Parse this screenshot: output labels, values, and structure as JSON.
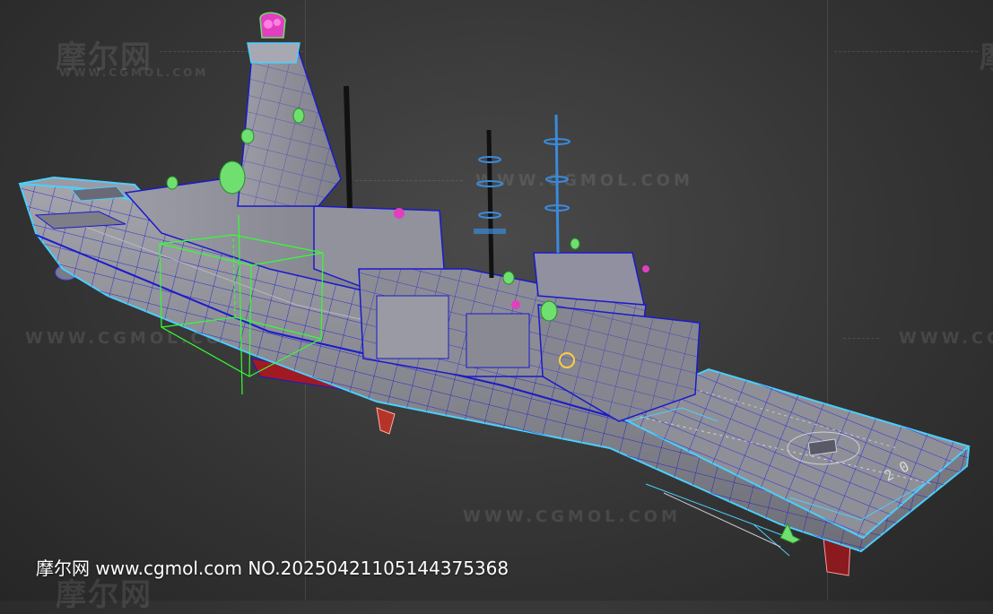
{
  "image": {
    "subject": "3D wireframe model of a naval frigate",
    "caption": "摩尔网 www.cgmol.com NO.20250421105144375368",
    "hull_number": "2 0",
    "watermark_cn": "摩尔网",
    "watermark_url": "WWW.CGMOL.COM",
    "colors": {
      "background": "#353535",
      "hull_fill": "#8e8e96",
      "wire": "#1a1acc",
      "outline": "#4ad0ff",
      "selection_box": "#33ff33",
      "keel_red": "#a11a22",
      "radome_green": "#6fe06f",
      "accent_magenta": "#e040c0"
    }
  }
}
